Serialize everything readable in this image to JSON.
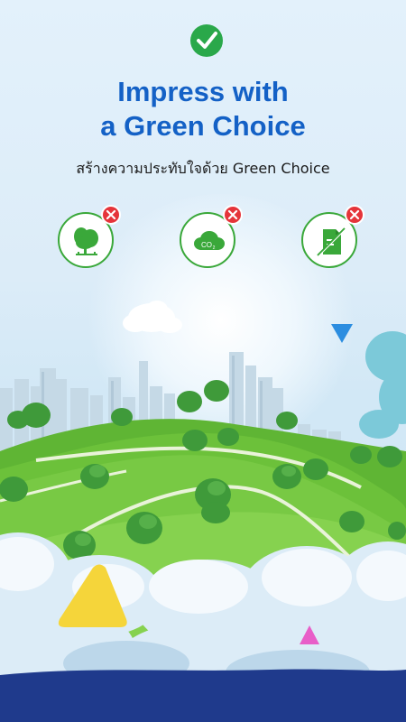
{
  "headline": {
    "line1": "Impress with",
    "line2": "a Green Choice"
  },
  "subtitle": "สร้างความประทับใจด้วย Green Choice",
  "icons": [
    {
      "name": "tree-icon",
      "badge": "close-icon"
    },
    {
      "name": "co2-cloud-icon",
      "label": "CO",
      "sub": "2",
      "badge": "close-icon"
    },
    {
      "name": "paper-icon",
      "badge": "close-icon"
    }
  ],
  "colors": {
    "accent_blue": "#1461c6",
    "green": "#3aa83a",
    "badge_red": "#e5343a",
    "check_green": "#2aa84a",
    "triangle_yellow": "#f5d53a",
    "triangle_pink": "#e85ec8",
    "triangle_blue": "#2b8de0"
  }
}
